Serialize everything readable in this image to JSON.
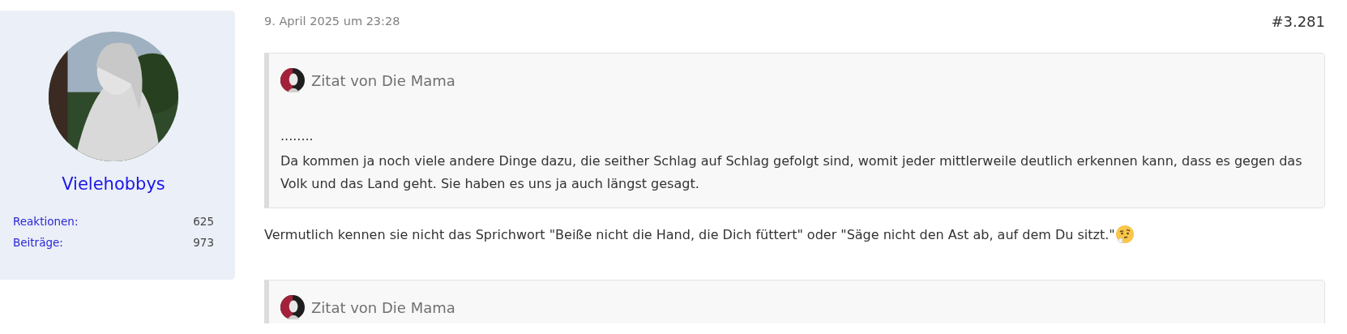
{
  "author": {
    "name": "Vielehobbys",
    "stats": [
      {
        "label": "Reaktionen:",
        "value": "625"
      },
      {
        "label": "Beiträge:",
        "value": "973"
      }
    ]
  },
  "post": {
    "date": "9. April 2025 um 23:28",
    "number": "#3.281",
    "blocks": [
      {
        "kind": "quote",
        "header": "Zitat von Die Mama",
        "lines": [
          "........",
          "Da kommen ja noch viele andere Dinge dazu, die seither Schlag auf Schlag gefolgt sind, womit jeder mittlerweile deutlich erkennen kann, dass es gegen das Volk und das Land geht. Sie haben es uns ja auch längst gesagt."
        ]
      },
      {
        "kind": "text",
        "text": "Vermutlich kennen sie nicht das Sprichwort \"Beiße nicht die Hand, die Dich füttert\" oder \"Säge nicht den Ast ab, auf dem Du sitzt.\"",
        "emoji": true
      },
      {
        "kind": "quote",
        "header": "Zitat von Die Mama"
      }
    ]
  }
}
